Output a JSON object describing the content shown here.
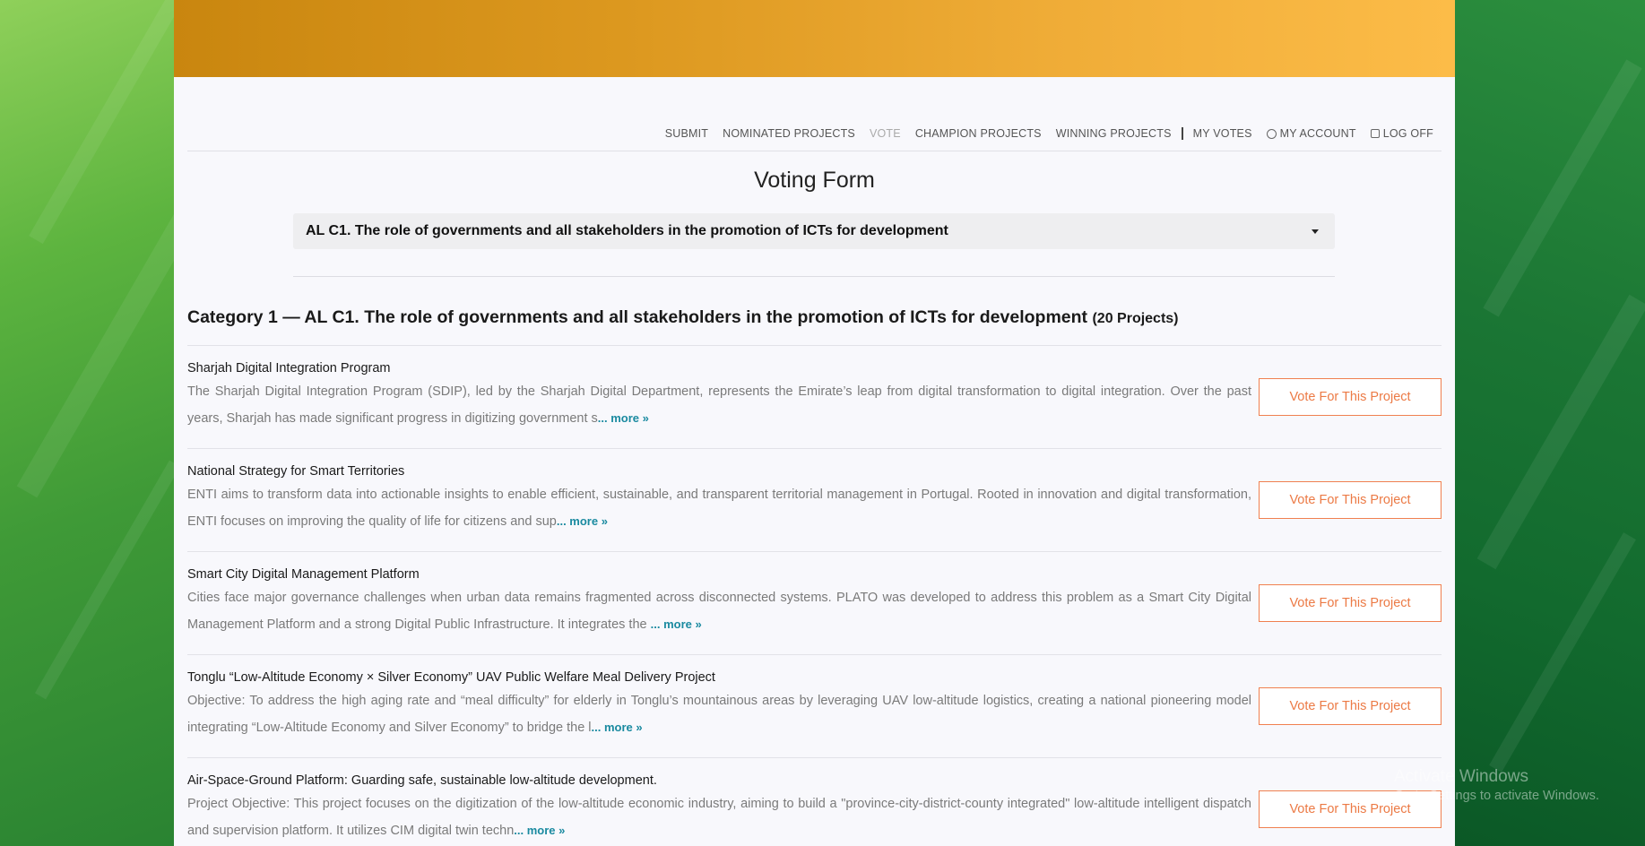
{
  "nav": {
    "submit": "SUBMIT",
    "nominated": "NOMINATED PROJECTS",
    "vote": "VOTE",
    "champion": "CHAMPION PROJECTS",
    "winning": "WINNING PROJECTS",
    "my_votes": "MY VOTES",
    "my_account": "MY ACCOUNT",
    "log_off": "LOG OFF"
  },
  "page_title": "Voting Form",
  "category_select": {
    "selected": "AL C1. The role of governments and all stakeholders in the promotion of ICTs for development"
  },
  "category_heading": {
    "title": "Category 1 — AL C1. The role of governments and all stakeholders in the promotion of ICTs for development",
    "count": "(20 Projects)"
  },
  "more_label": "... more »",
  "vote_label": "Vote For This Project",
  "projects": [
    {
      "title": "Sharjah Digital Integration Program",
      "desc": "The Sharjah Digital Integration Program (SDIP), led by the Sharjah Digital Department, represents the Emirate’s leap from digital transformation to digital integration. Over the past years, Sharjah has made significant progress in digitizing government s"
    },
    {
      "title": "National Strategy for Smart Territories",
      "desc": "ENTI aims to transform data into actionable insights to enable efficient, sustainable, and transparent territorial management in Portugal. Rooted in innovation and digital transformation, ENTI focuses on improving the quality of life for citizens and sup"
    },
    {
      "title": "Smart City Digital Management Platform",
      "desc": "Cities face major governance challenges when urban data remains fragmented across disconnected systems. PLATO was developed to address this problem as a Smart City Digital Management Platform and a strong Digital Public Infrastructure. It integrates the "
    },
    {
      "title": "Tonglu “Low-Altitude Economy × Silver Economy” UAV Public Welfare Meal Delivery Project",
      "desc": "Objective: To address the high aging rate and “meal difficulty” for elderly in Tonglu’s mountainous areas by leveraging UAV low-altitude logistics, creating a national pioneering model integrating “Low-Altitude Economy and Silver Economy” to bridge the l"
    },
    {
      "title": "Air-Space-Ground Platform: Guarding safe, sustainable low-altitude development.",
      "desc": "Project Objective: This project focuses on the digitization of the low-altitude economic industry, aiming to build a \"province-city-district-county integrated\" low-altitude intelligent dispatch and supervision platform. It utilizes CIM digital twin techn"
    }
  ],
  "watermark": {
    "title": "Activate Windows",
    "subtitle": "Go to Settings to activate Windows."
  }
}
